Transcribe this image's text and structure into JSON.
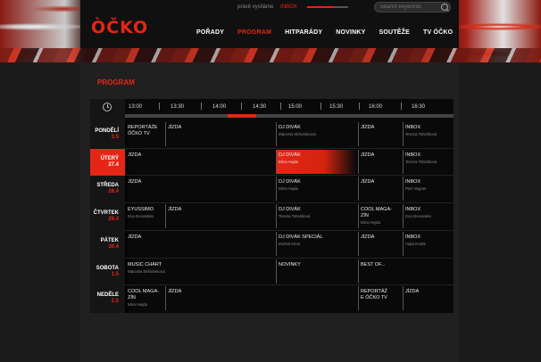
{
  "header": {
    "logo": "ÒČKO",
    "onair_label": "právě vysíláme",
    "onair_value": "INBOX",
    "search_placeholder": "Search keywords",
    "nav": [
      "POŘADY",
      "PROGRAM",
      "HITPARÁDY",
      "NOVINKY",
      "SOUTĚŽE",
      "TV ÓČKO"
    ],
    "nav_active": "PROGRAM"
  },
  "page": {
    "title": "PROGRAM"
  },
  "colors": {
    "accent": "#e52616",
    "background": "#1c1c1c",
    "grid": "#090909"
  },
  "icons": {
    "clock": "clock-icon",
    "search": "search-icon"
  },
  "schedule": {
    "times": [
      "13:00",
      "13:30",
      "14:00",
      "14:30",
      "15:00",
      "15:30",
      "16:00",
      "16:30"
    ],
    "days": [
      {
        "name": "PONDĚLÍ",
        "date": "3.5",
        "active": false
      },
      {
        "name": "ÚTERÝ",
        "date": "27.4",
        "active": true
      },
      {
        "name": "STŘEDA",
        "date": "28.4",
        "active": false
      },
      {
        "name": "ČTVRTEK",
        "date": "29.4",
        "active": false
      },
      {
        "name": "PÁTEK",
        "date": "30.4",
        "active": false
      },
      {
        "name": "SOBOTA",
        "date": "1.5",
        "active": false
      },
      {
        "name": "NEDĚLE",
        "date": "2.5",
        "active": false
      }
    ],
    "rows": [
      [
        {
          "title": "REPORTÁŽE\nÓČKO TV",
          "sub": ""
        },
        {
          "title": "JÍZDA",
          "sub": ""
        },
        {
          "title": "DJ DIVÁK",
          "sub": "Marcela Skřivánková"
        },
        {
          "title": "JÍZDA",
          "sub": ""
        },
        {
          "title": "INBOX",
          "sub": "Tereza Tobrášová"
        }
      ],
      [
        {
          "title": "JÍZDA",
          "sub": ""
        },
        {
          "title": "DJ DIVÁK",
          "sub": "Míra Hejda",
          "highlight": true
        },
        {
          "title": "JÍZDA",
          "sub": ""
        },
        {
          "title": "INBOX",
          "sub": "Tereza Tobrášová"
        }
      ],
      [
        {
          "title": "JÍZDA",
          "sub": ""
        },
        {
          "title": "DJ DIVÁK",
          "sub": "Míra Hejda"
        },
        {
          "title": "JÍZDA",
          "sub": ""
        },
        {
          "title": "INBOX",
          "sub": "Petr Vagner"
        }
      ],
      [
        {
          "title": "EYUSSIMO",
          "sub": "Eva Decastelo"
        },
        {
          "title": "JÍZDA",
          "sub": ""
        },
        {
          "title": "DJ DIVÁK",
          "sub": "Tereza Tobrášová"
        },
        {
          "title": "COOL MAGA-\nZÍN",
          "sub": "Míra Hejda"
        },
        {
          "title": "INBOX",
          "sub": "Eva Decastelo"
        }
      ],
      [
        {
          "title": "JÍZDA",
          "sub": ""
        },
        {
          "title": "DJ DIVÁK SPECIÁL",
          "sub": "Michal Klein"
        },
        {
          "title": "JÍZDA",
          "sub": ""
        },
        {
          "title": "INBOX",
          "sub": "Vojta Kotek"
        }
      ],
      [
        {
          "title": "MUSIC CHART",
          "sub": "Marcela Skřivánková"
        },
        {
          "title": "NOVINKY",
          "sub": ""
        },
        {
          "title": "BEST OF...",
          "sub": ""
        }
      ],
      [
        {
          "title": "COOL MAGA-\nZÍN",
          "sub": "Míra Hejda"
        },
        {
          "title": "JÍZDA",
          "sub": ""
        },
        {
          "title": "REPORTÁŽ\nE ÓČKO TV",
          "sub": ""
        },
        {
          "title": "JÍZDA",
          "sub": ""
        }
      ]
    ]
  }
}
